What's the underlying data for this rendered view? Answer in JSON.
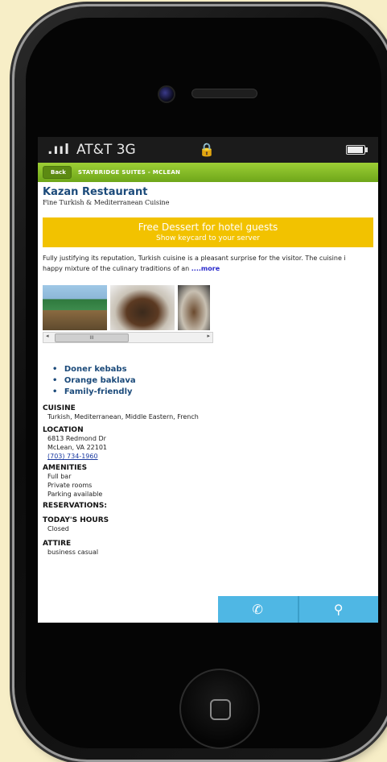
{
  "status": {
    "signal": ".ııl",
    "carrier": "AT&T 3G",
    "lock": "🔒"
  },
  "nav": {
    "back_label": "Back",
    "title": "STAYBRIDGE SUITES - MCLEAN"
  },
  "restaurant": {
    "name": "Kazan Restaurant",
    "subtitle": "Fine Turkish & Mediterranean Cuisine"
  },
  "promo": {
    "title": "Free Dessert for hotel guests",
    "subtitle": "Show keycard to your server"
  },
  "description": {
    "line1": "Fully justifying its reputation, Turkish cuisine is a pleasant surprise for the visitor. The cuisine i",
    "line2": "happy mixture of the culinary traditions of an",
    "more": "....more"
  },
  "gallery": {
    "scroll_left": "◂",
    "scroll_right": "▸",
    "thumb_mark": "III"
  },
  "highlights": [
    "Doner kebabs",
    "Orange baklava",
    "Family-friendly"
  ],
  "sections": {
    "cuisine_title": "CUISINE",
    "cuisine_value": "Turkish, Mediterranean, Middle Eastern, French",
    "location_title": "LOCATION",
    "address1": "6813 Redmond Dr",
    "address2": "McLean, VA 22101",
    "phone": "(703) 734-1960",
    "amenities_title": "AMENITIES",
    "amenities": [
      "Full bar",
      "Private rooms",
      "Parking available"
    ],
    "reservations_title": "RESERVATIONS:",
    "hours_title": "TODAY'S HOURS",
    "hours_value": "Closed",
    "attire_title": "ATTIRE",
    "attire_value": "business casual"
  },
  "actions": {
    "call_icon": "✆",
    "map_icon": "⚲"
  }
}
